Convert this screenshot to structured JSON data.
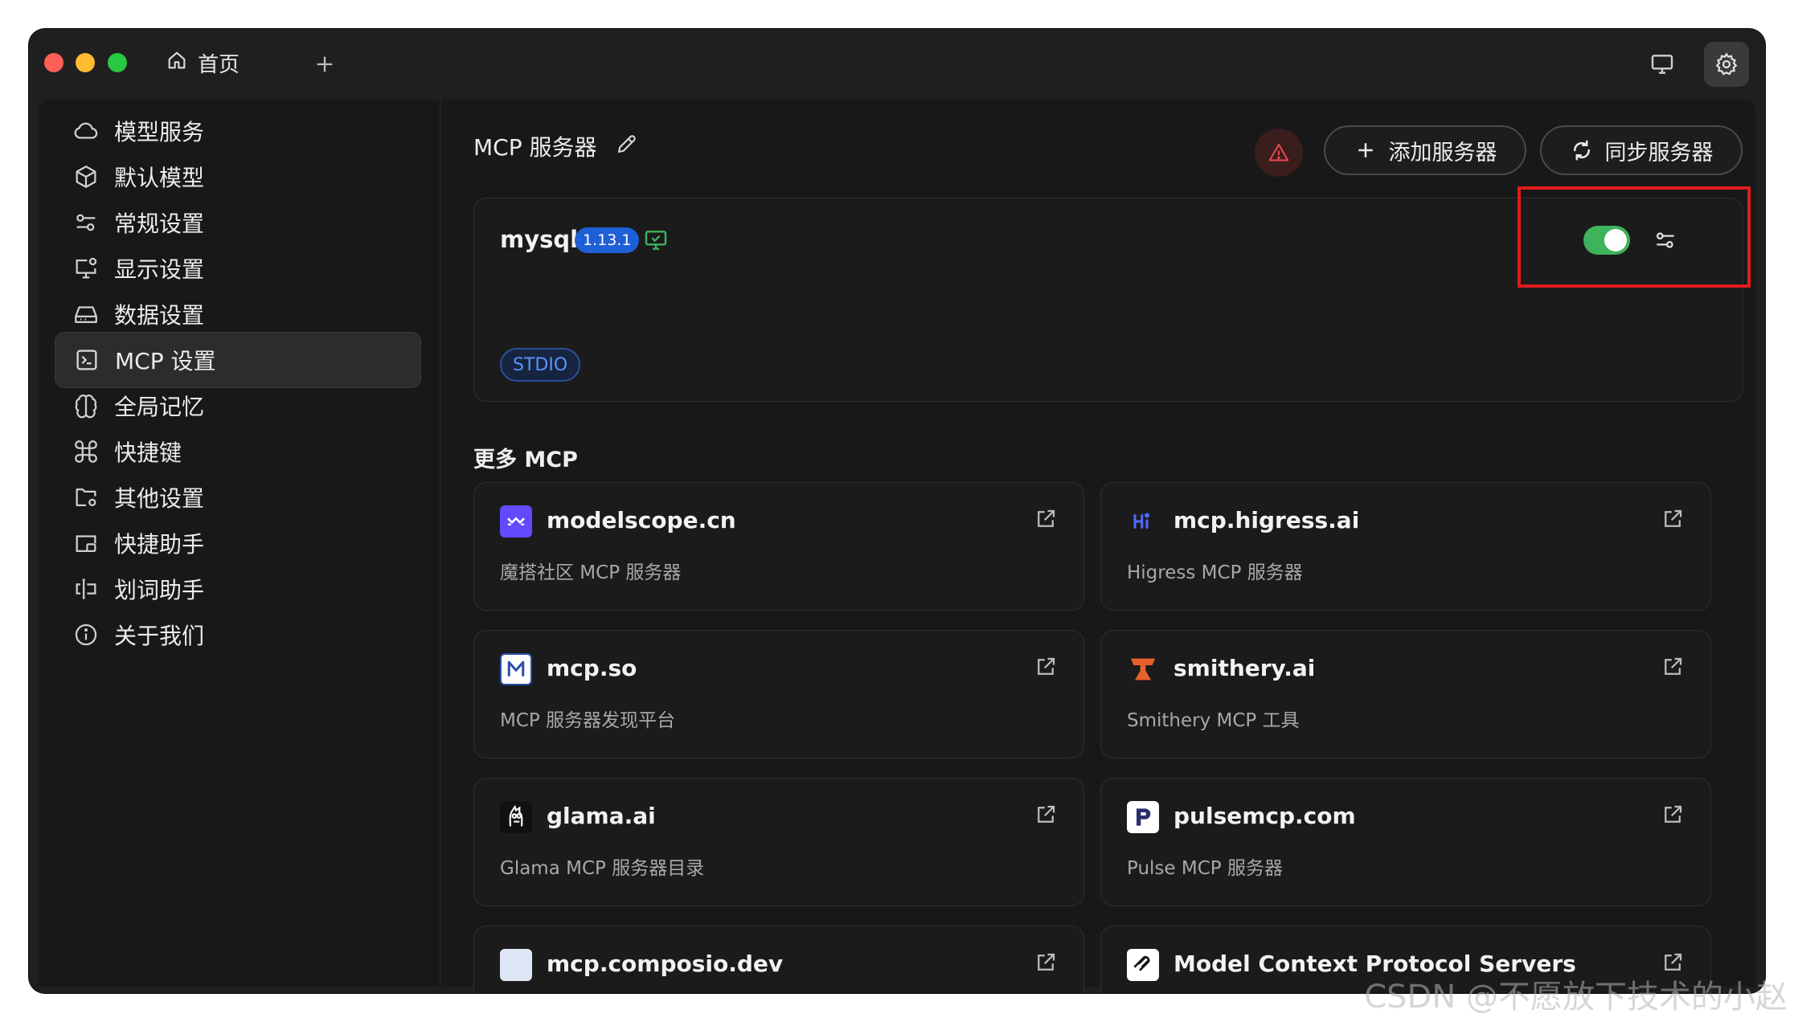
{
  "titlebar": {
    "home_tab_label": "首页"
  },
  "sidebar": {
    "items": [
      {
        "label": "模型服务",
        "icon": "cloud-icon"
      },
      {
        "label": "默认模型",
        "icon": "cube-icon"
      },
      {
        "label": "常规设置",
        "icon": "sliders-icon"
      },
      {
        "label": "显示设置",
        "icon": "monitor-settings-icon"
      },
      {
        "label": "数据设置",
        "icon": "hard-drive-icon"
      },
      {
        "label": "MCP 设置",
        "icon": "terminal-icon",
        "active": true
      },
      {
        "label": "全局记忆",
        "icon": "brain-icon"
      },
      {
        "label": "快捷键",
        "icon": "command-icon"
      },
      {
        "label": "其他设置",
        "icon": "folder-settings-icon"
      },
      {
        "label": "快捷助手",
        "icon": "app-window-icon"
      },
      {
        "label": "划词助手",
        "icon": "text-cursor-icon"
      },
      {
        "label": "关于我们",
        "icon": "info-icon"
      }
    ]
  },
  "main": {
    "title": "MCP 服务器",
    "add_button": "添加服务器",
    "sync_button": "同步服务器",
    "server": {
      "name": "mysql",
      "version": "1.13.1",
      "enabled": true,
      "transport": "STDIO"
    },
    "more_title": "更多 MCP",
    "providers": [
      {
        "name": "modelscope.cn",
        "desc": "魔搭社区 MCP 服务器",
        "icon": "modelscope-logo-icon",
        "icon_color": "#624aff"
      },
      {
        "name": "mcp.higress.ai",
        "desc": "Higress MCP 服务器",
        "icon": "higress-logo-icon",
        "icon_color": "#4f6bff"
      },
      {
        "name": "mcp.so",
        "desc": "MCP 服务器发现平台",
        "icon": "mcp-so-logo-icon",
        "icon_color": "#2b4fa8"
      },
      {
        "name": "smithery.ai",
        "desc": "Smithery MCP 工具",
        "icon": "smithery-logo-icon",
        "icon_color": "#e8612c"
      },
      {
        "name": "glama.ai",
        "desc": "Glama MCP 服务器目录",
        "icon": "glama-logo-icon",
        "icon_color": "#111111"
      },
      {
        "name": "pulsemcp.com",
        "desc": "Pulse MCP 服务器",
        "icon": "pulsemcp-logo-icon",
        "icon_color": "#2a2f6b"
      },
      {
        "name": "mcp.composio.dev",
        "desc": "",
        "icon": "composio-logo-icon",
        "icon_color": "#dfe6f5"
      },
      {
        "name": "Model Context Protocol Servers",
        "desc": "",
        "icon": "mcp-protocol-logo-icon",
        "icon_color": "#ffffff"
      }
    ]
  },
  "watermark": "CSDN @不愿放下技术的小赵",
  "colors": {
    "accent_toggle": "#3fb25c",
    "version_badge": "#1f5fd6",
    "highlight_border": "#e01b1b",
    "warning": "#e5484d"
  }
}
